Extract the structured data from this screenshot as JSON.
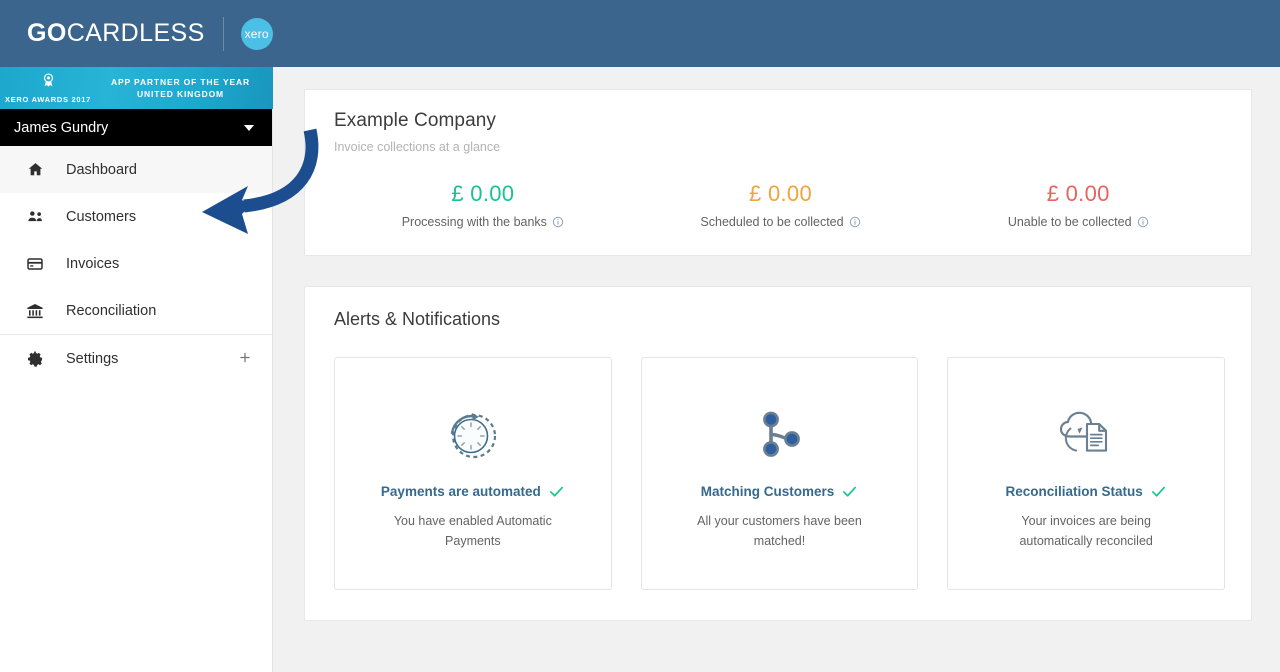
{
  "brand": {
    "name_bold": "GO",
    "name_light": "CARDLESS",
    "partner_badge": "xero",
    "divider_icon": "vertical-divider"
  },
  "sidebar": {
    "awards": {
      "rosette_icon": "award-rosette-icon",
      "left_text": "XERO AWARDS 2017",
      "line1": "APP PARTNER OF THE YEAR",
      "line2": "UNITED KINGDOM"
    },
    "user": {
      "name": "James Gundry",
      "caret_icon": "chevron-down-icon"
    },
    "items": [
      {
        "label": "Dashboard",
        "icon": "home-icon",
        "active": true
      },
      {
        "label": "Customers",
        "icon": "people-icon",
        "active": false
      },
      {
        "label": "Invoices",
        "icon": "card-icon",
        "active": false
      },
      {
        "label": "Reconciliation",
        "icon": "bank-icon",
        "active": false
      },
      {
        "label": "Settings",
        "icon": "gear-icon",
        "active": false,
        "expand_icon": "plus-icon"
      }
    ]
  },
  "annotation": {
    "arrow_icon": "curved-left-arrow",
    "color": "#1c4e8f",
    "points_to": "Customers"
  },
  "summary": {
    "company": "Example Company",
    "subtitle": "Invoice collections at a glance",
    "stats": [
      {
        "value": "£ 0.00",
        "label": "Processing with the banks",
        "color": "#19c195",
        "info_icon": "info-circle-icon"
      },
      {
        "value": "£ 0.00",
        "label": "Scheduled to be collected",
        "color": "#f1a33c",
        "info_icon": "info-circle-icon"
      },
      {
        "value": "£ 0.00",
        "label": "Unable to be collected",
        "color": "#e8635f",
        "info_icon": "info-circle-icon"
      }
    ]
  },
  "alerts": {
    "title": "Alerts & Notifications",
    "cards": [
      {
        "icon": "automated-clock-icon",
        "heading": "Payments are automated",
        "status_icon": "green-check-icon",
        "description": "You have enabled Automatic Payments"
      },
      {
        "icon": "customer-match-nodes-icon",
        "heading": "Matching Customers",
        "status_icon": "green-check-icon",
        "description": "All your customers have been matched!"
      },
      {
        "icon": "cloud-document-sync-icon",
        "heading": "Reconciliation Status",
        "status_icon": "green-check-icon",
        "description": "Your invoices are being automatically reconciled"
      }
    ]
  },
  "colors": {
    "header_blue": "#3c658e",
    "awards_cyan": "#1fa9cf",
    "accent_teal": "#36698c",
    "check_green": "#16c98d",
    "page_bg": "#f1f1f1"
  }
}
